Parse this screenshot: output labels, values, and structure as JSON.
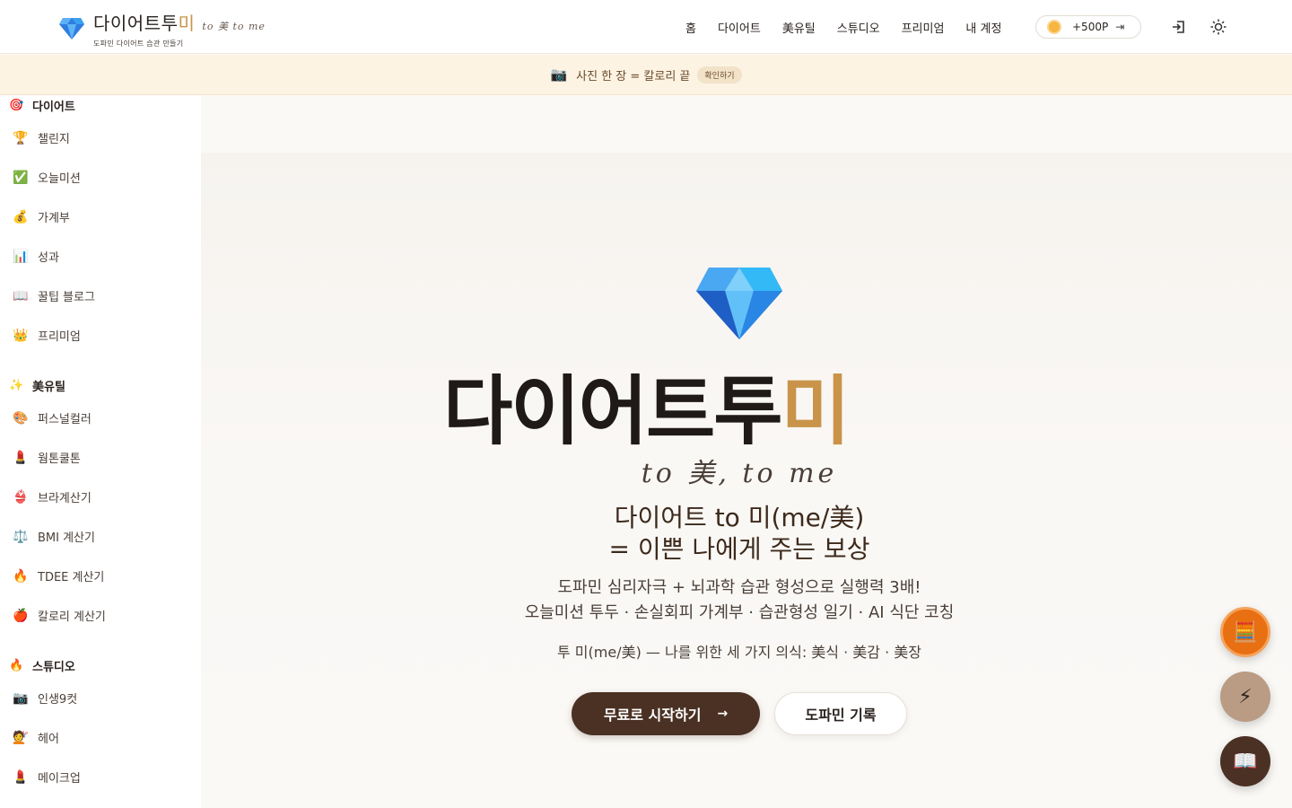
{
  "header": {
    "logo": {
      "title_main": "다이어트투",
      "title_accent": "미",
      "tagline": "to 美 to me",
      "subtitle": "도파민 다이어트 습관 만들기"
    },
    "nav": [
      "홈",
      "다이어트",
      "美유틸",
      "스튜디오",
      "프리미엄",
      "내 계정"
    ],
    "points": {
      "label": "+500P",
      "icon": "coin-icon"
    },
    "login_icon": "login-icon",
    "theme_icon": "sun-icon"
  },
  "banner": {
    "icon": "📷",
    "text": "사진 한 장 = 칼로리 끝",
    "cta": "확인하기"
  },
  "sidebar": {
    "sections": [
      {
        "title": "다이어트",
        "icon": "🎯",
        "items": [
          {
            "label": "챌린지",
            "icon": "🏆"
          },
          {
            "label": "오늘미션",
            "icon": "✅"
          },
          {
            "label": "가계부",
            "icon": "💰"
          },
          {
            "label": "성과",
            "icon": "📊"
          },
          {
            "label": "꿀팁 블로그",
            "icon": "📖"
          },
          {
            "label": "프리미엄",
            "icon": "👑"
          }
        ]
      },
      {
        "title": "美유틸",
        "icon": "✨",
        "items": [
          {
            "label": "퍼스널컬러",
            "icon": "🎨"
          },
          {
            "label": "웜톤쿨톤",
            "icon": "💄"
          },
          {
            "label": "브라계산기",
            "icon": "👙"
          },
          {
            "label": "BMI 계산기",
            "icon": "⚖️"
          },
          {
            "label": "TDEE 계산기",
            "icon": "🔥"
          },
          {
            "label": "칼로리 계산기",
            "icon": "🍎"
          }
        ]
      },
      {
        "title": "스튜디오",
        "icon": "🔥",
        "items": [
          {
            "label": "인생9컷",
            "icon": "📷"
          },
          {
            "label": "헤어",
            "icon": "💇"
          },
          {
            "label": "메이크업",
            "icon": "💄"
          }
        ]
      }
    ]
  },
  "hero": {
    "title_main": "다이어트투",
    "title_accent": "미",
    "tagline": "to 美, to me",
    "subtitle_line1": "다이어트 to 미(me/美)",
    "subtitle_line2": "= 이쁜 나에게 주는 보상",
    "desc_line1": "도파민 심리자극 + 뇌과학 습관 형성으로 실행력 3배!",
    "desc_line2": "오늘미션 투두 · 손실회피 가계부 · 습관형성 일기 · AI 식단 코칭",
    "ritual": "투 미(me/美) — 나를 위한 세 가지 의식: 美식 · 美감 · 美장",
    "primary_button": "무료로 시작하기",
    "secondary_button": "도파민 기록"
  },
  "fabs": [
    {
      "name": "calculator-fab",
      "icon": "🧮"
    },
    {
      "name": "energy-fab",
      "icon": "⚡"
    },
    {
      "name": "book-fab",
      "icon": "📖"
    }
  ],
  "colors": {
    "accent_gold": "#c9944a",
    "brand_brown": "#4a3124",
    "banner_bg": "#fdf3e3",
    "fab_orange": "#e86f12"
  }
}
